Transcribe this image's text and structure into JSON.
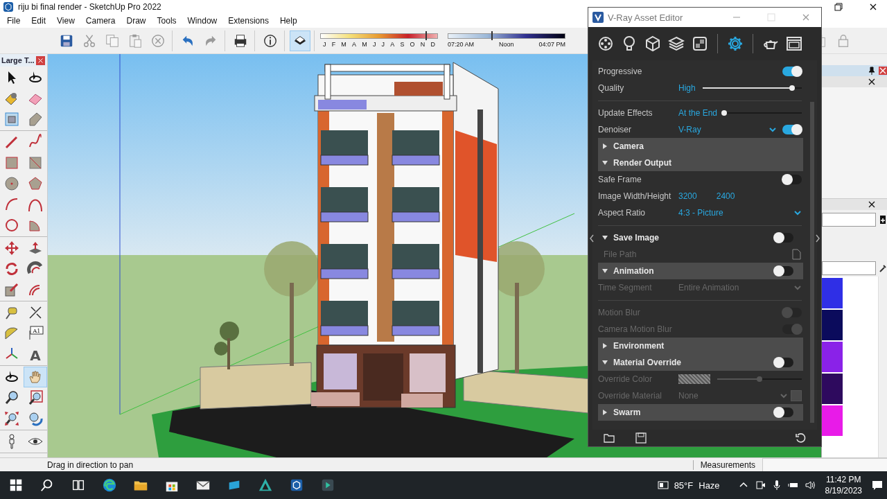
{
  "window": {
    "title": "riju bi final render - SketchUp Pro 2022"
  },
  "menu": [
    "File",
    "Edit",
    "View",
    "Camera",
    "Draw",
    "Tools",
    "Window",
    "Extensions",
    "Help"
  ],
  "toolbar": {
    "button_groups": [
      [
        {
          "kind": "save",
          "disabled": false,
          "pressed": false
        },
        {
          "kind": "cut",
          "disabled": true,
          "pressed": false
        },
        {
          "kind": "copy",
          "disabled": true,
          "pressed": false
        },
        {
          "kind": "paste",
          "disabled": true,
          "pressed": false
        },
        {
          "kind": "delete",
          "disabled": true,
          "pressed": false
        }
      ],
      [
        {
          "kind": "undo",
          "disabled": false,
          "pressed": false
        },
        {
          "kind": "redo",
          "disabled": true,
          "pressed": false
        }
      ],
      [
        {
          "kind": "print",
          "disabled": false,
          "pressed": false
        }
      ],
      [
        {
          "kind": "info",
          "disabled": false,
          "pressed": false
        }
      ],
      [
        {
          "kind": "shadows",
          "disabled": false,
          "pressed": true
        }
      ]
    ],
    "months": [
      "J",
      "F",
      "M",
      "A",
      "M",
      "J",
      "J",
      "A",
      "S",
      "O",
      "N",
      "D"
    ],
    "date_slider": {
      "level": 0.9
    },
    "times": [
      "07:20 AM",
      "Noon",
      "04:07 PM"
    ],
    "time_slider": {
      "level": 0.37
    },
    "end_buttons": [
      {
        "kind": "component-lock",
        "disabled": true
      },
      {
        "kind": "lock",
        "disabled": true
      }
    ]
  },
  "tool_palette": {
    "title": "Large T...",
    "groups": [
      [
        {
          "kind": "select",
          "selected": false
        },
        {
          "kind": "orbit",
          "selected": false
        },
        {
          "kind": "paint",
          "selected": false
        },
        {
          "kind": "eraser",
          "selected": false
        },
        {
          "kind": "component",
          "selected": false
        },
        {
          "kind": "tag",
          "selected": false
        }
      ],
      [
        {
          "kind": "pencil",
          "selected": false
        },
        {
          "kind": "freehand",
          "selected": false
        },
        {
          "kind": "rectangle",
          "selected": false
        },
        {
          "kind": "rotated",
          "selected": false
        },
        {
          "kind": "circle",
          "selected": false
        },
        {
          "kind": "polygon",
          "selected": false
        },
        {
          "kind": "arc",
          "selected": false
        },
        {
          "kind": "arc2",
          "selected": false
        },
        {
          "kind": "arc3",
          "selected": false
        },
        {
          "kind": "pie",
          "selected": false
        }
      ],
      [
        {
          "kind": "move",
          "selected": false
        },
        {
          "kind": "pushpull",
          "selected": false
        },
        {
          "kind": "rotate",
          "selected": false
        },
        {
          "kind": "followme",
          "selected": false
        },
        {
          "kind": "scale",
          "selected": false
        },
        {
          "kind": "offset",
          "selected": false
        }
      ],
      [
        {
          "kind": "tape",
          "selected": false
        },
        {
          "kind": "dimension",
          "selected": false
        },
        {
          "kind": "protractor",
          "selected": false
        },
        {
          "kind": "text",
          "selected": false,
          "glyph": "A1"
        },
        {
          "kind": "axes",
          "selected": false
        },
        {
          "kind": "text3d",
          "selected": false,
          "glyph": "A"
        }
      ],
      [
        {
          "kind": "orbit",
          "selected": false
        },
        {
          "kind": "pan",
          "selected": true
        },
        {
          "kind": "zoom",
          "selected": false
        },
        {
          "kind": "zoomwindow",
          "selected": false
        },
        {
          "kind": "extents",
          "selected": false
        },
        {
          "kind": "previous",
          "selected": false
        }
      ],
      [
        {
          "kind": "walk",
          "selected": false
        },
        {
          "kind": "look",
          "selected": false
        }
      ]
    ]
  },
  "vray": {
    "title": "V-Ray Asset Editor",
    "tabs": [
      {
        "kind": "materials",
        "selected": false
      },
      {
        "kind": "lights",
        "selected": false
      },
      {
        "kind": "geometry",
        "selected": false
      },
      {
        "kind": "layers",
        "selected": false
      },
      {
        "kind": "textures",
        "selected": false
      },
      {
        "kind": "settings",
        "selected": true
      },
      {
        "kind": "render",
        "selected": false
      },
      {
        "kind": "framebuffer",
        "selected": false
      }
    ],
    "rows": [
      {
        "kind": "toggle",
        "label": "Progressive",
        "on": true,
        "disabled": false
      },
      {
        "kind": "slider",
        "label": "Quality",
        "value": "High",
        "level": 0.9,
        "disabled": false
      },
      {
        "kind": "divider"
      },
      {
        "kind": "slider",
        "label": "Update Effects",
        "value": "At the End",
        "level": 0.0,
        "disabled": false
      },
      {
        "kind": "dropdown",
        "label": "Denoiser",
        "value": "V-Ray",
        "on": true,
        "disabled": false
      },
      {
        "kind": "section",
        "label": "Camera",
        "expanded": false,
        "shaded": true
      },
      {
        "kind": "section",
        "label": "Render Output",
        "expanded": true,
        "shaded": true
      },
      {
        "kind": "toggle",
        "label": "Safe Frame",
        "on": false,
        "disabled": false
      },
      {
        "kind": "pair",
        "label": "Image Width/Height",
        "values": [
          "3200",
          "2400"
        ],
        "disabled": false
      },
      {
        "kind": "dropdown",
        "label": "Aspect Ratio",
        "value": "4:3 - Picture",
        "disabled": false
      },
      {
        "kind": "divider"
      },
      {
        "kind": "section",
        "label": "Save Image",
        "expanded": true,
        "shaded": false,
        "on": false
      },
      {
        "kind": "file",
        "label": "File Path",
        "disabled": true
      },
      {
        "kind": "section",
        "label": "Animation",
        "expanded": true,
        "shaded": true,
        "on": false
      },
      {
        "kind": "dropdown",
        "label": "Time Segment",
        "value": "Entire Animation",
        "disabled": true
      },
      {
        "kind": "divider"
      },
      {
        "kind": "toggle",
        "label": "Motion Blur",
        "on": false,
        "disabled": true
      },
      {
        "kind": "toggle",
        "label": "Camera Motion Blur",
        "on": true,
        "disabled": true
      },
      {
        "kind": "section",
        "label": "Environment",
        "expanded": false,
        "shaded": true
      },
      {
        "kind": "section",
        "label": "Material Override",
        "expanded": true,
        "shaded": true,
        "on": false
      },
      {
        "kind": "color",
        "label": "Override Color",
        "level": 0.5,
        "disabled": true
      },
      {
        "kind": "material",
        "label": "Override Material",
        "value": "None",
        "disabled": true
      },
      {
        "kind": "section",
        "label": "Swarm",
        "expanded": false,
        "shaded": true,
        "on": false
      }
    ]
  },
  "tray": {
    "swatches": [
      {
        "color": "#2f2fe6"
      },
      {
        "color": "#0b0b5c"
      },
      {
        "color": "#8a22e8"
      },
      {
        "color": "#2e0a5e"
      },
      {
        "color": "#e81be8"
      }
    ]
  },
  "status_bar": {
    "hint": "Drag in direction to pan",
    "measurements_label": "Measurements"
  },
  "taskbar": {
    "apps": [
      {
        "kind": "taskview"
      },
      {
        "kind": "edge"
      },
      {
        "kind": "explorer"
      },
      {
        "kind": "store"
      },
      {
        "kind": "mail"
      },
      {
        "kind": "tile"
      },
      {
        "kind": "triangle"
      },
      {
        "kind": "sketchup"
      },
      {
        "kind": "dark-app"
      }
    ],
    "temperature": "85°F",
    "condition": "Haze",
    "time": "11:42 PM",
    "date": "8/19/2023"
  }
}
